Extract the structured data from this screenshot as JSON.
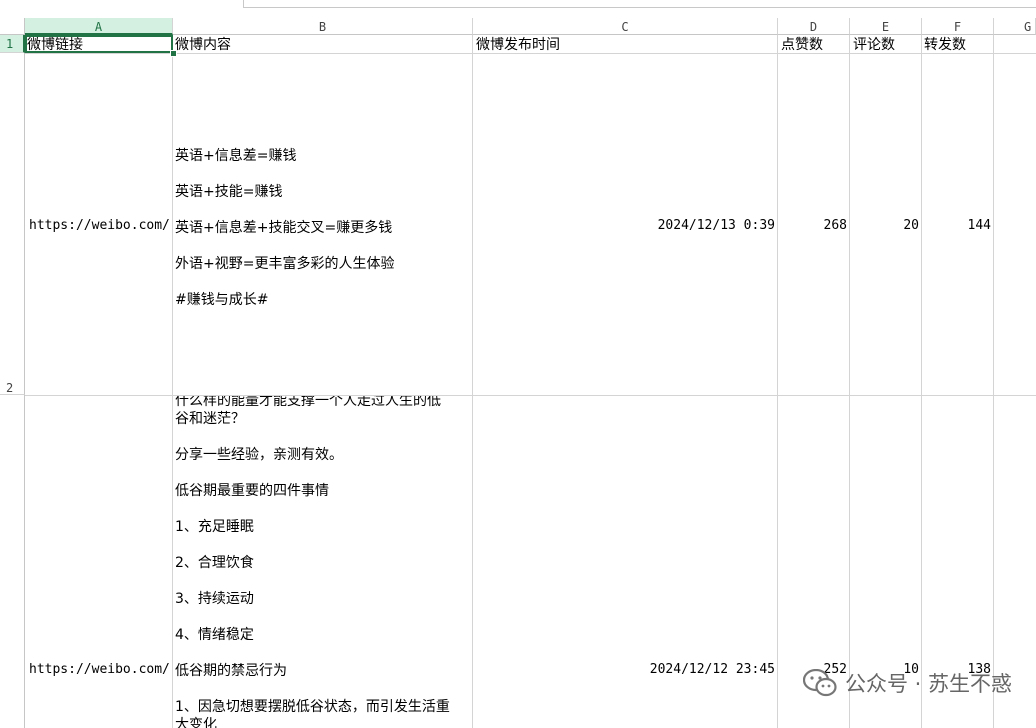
{
  "columns": [
    "A",
    "B",
    "C",
    "D",
    "E",
    "F",
    "G"
  ],
  "rows": [
    "1",
    "2"
  ],
  "headers": {
    "a": "微博链接",
    "b": "微博内容",
    "c": "微博发布时间",
    "d": "点赞数",
    "e": "评论数",
    "f": "转发数"
  },
  "row2": {
    "link": "https://weibo.com/",
    "content_lines": [
      "英语+信息差=赚钱",
      "英语+技能=赚钱",
      "英语+信息差+技能交叉=赚更多钱",
      "外语+视野=更丰富多彩的人生体验",
      "#赚钱与成长#"
    ],
    "time": "2024/12/13 0:39",
    "likes": "268",
    "comments": "20",
    "reposts": "144"
  },
  "row3": {
    "link": "https://weibo.com/",
    "content_lines": [
      "什么样的能量才能支撑一个人走过人生的低",
      "谷和迷茫？",
      "分享一些经验，亲测有效。",
      "低谷期最重要的四件事情",
      "1、充足睡眠",
      "2、合理饮食",
      "3、持续运动",
      "4、情绪稳定",
      "低谷期的禁忌行为",
      "1、因急切想要摆脱低谷状态，而引发生活重",
      "大变化"
    ],
    "time": "2024/12/12 23:45",
    "likes": "252",
    "comments": "10",
    "reposts": "138"
  },
  "watermark": {
    "text": "公众号 · 苏生不惑",
    "icon": "wechat-icon"
  },
  "colors": {
    "grid": "#d4d4d4",
    "selection": "#217346",
    "header_selected_bg": "#d3f0e0"
  }
}
